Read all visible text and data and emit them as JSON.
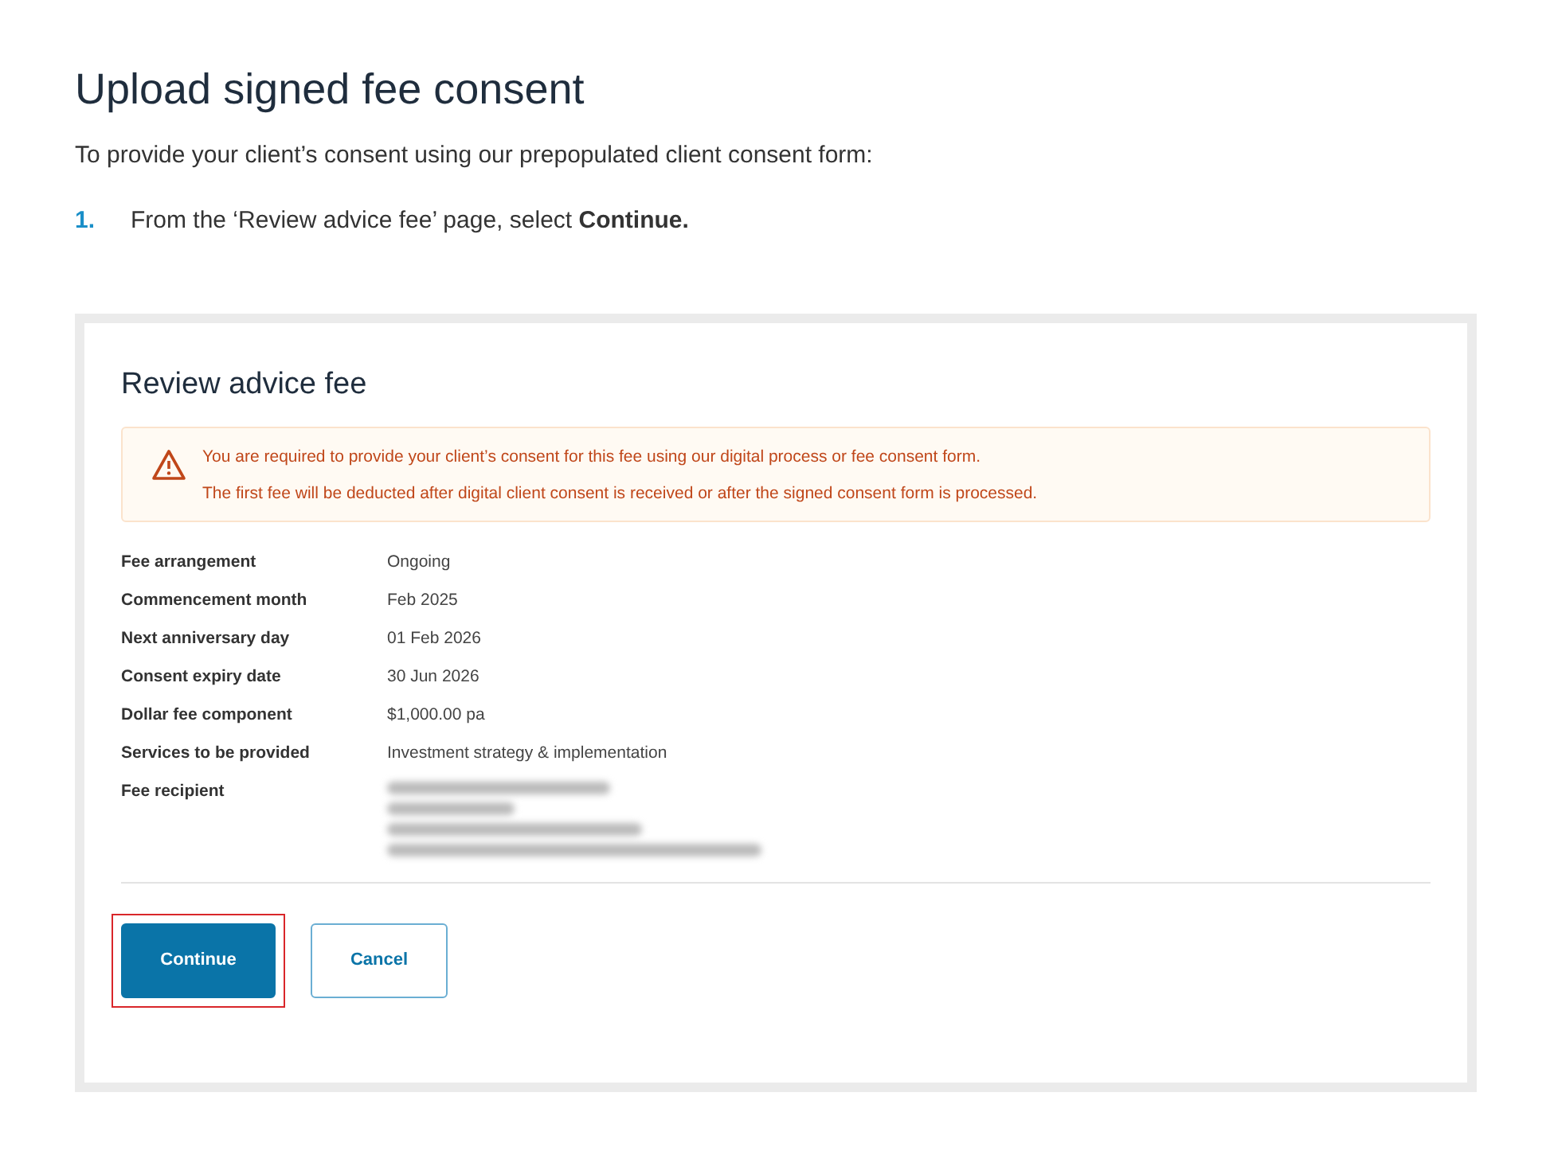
{
  "heading": "Upload signed fee consent",
  "intro": "To provide your client’s consent using our prepopulated client consent form:",
  "steps": [
    {
      "number": "1.",
      "text": "From the ‘Review advice fee’ page, select **Continue.**"
    }
  ],
  "card": {
    "title": "Review advice fee",
    "warning": {
      "lines": [
        "You are required to provide your client’s consent for this fee using our digital process or fee consent form.",
        "The first fee will be deducted after digital client consent is received or after the signed consent form is processed."
      ]
    },
    "details": [
      {
        "label": "Fee arrangement",
        "value": "Ongoing"
      },
      {
        "label": "Commencement month",
        "value": "Feb 2025"
      },
      {
        "label": "Next anniversary day",
        "value": "01 Feb 2026"
      },
      {
        "label": "Consent expiry date",
        "value": "30 Jun 2026"
      },
      {
        "label": "Dollar fee component",
        "value": "$1,000.00 pa"
      },
      {
        "label": "Services to be provided",
        "value": "Investment strategy & implementation"
      },
      {
        "label": "Fee recipient",
        "kind": "blurred"
      }
    ],
    "buttons": [
      {
        "label": "Continue",
        "kind": "primary",
        "highlighted": true
      },
      {
        "label": "Cancel",
        "kind": "secondary",
        "highlighted": false
      }
    ]
  }
}
